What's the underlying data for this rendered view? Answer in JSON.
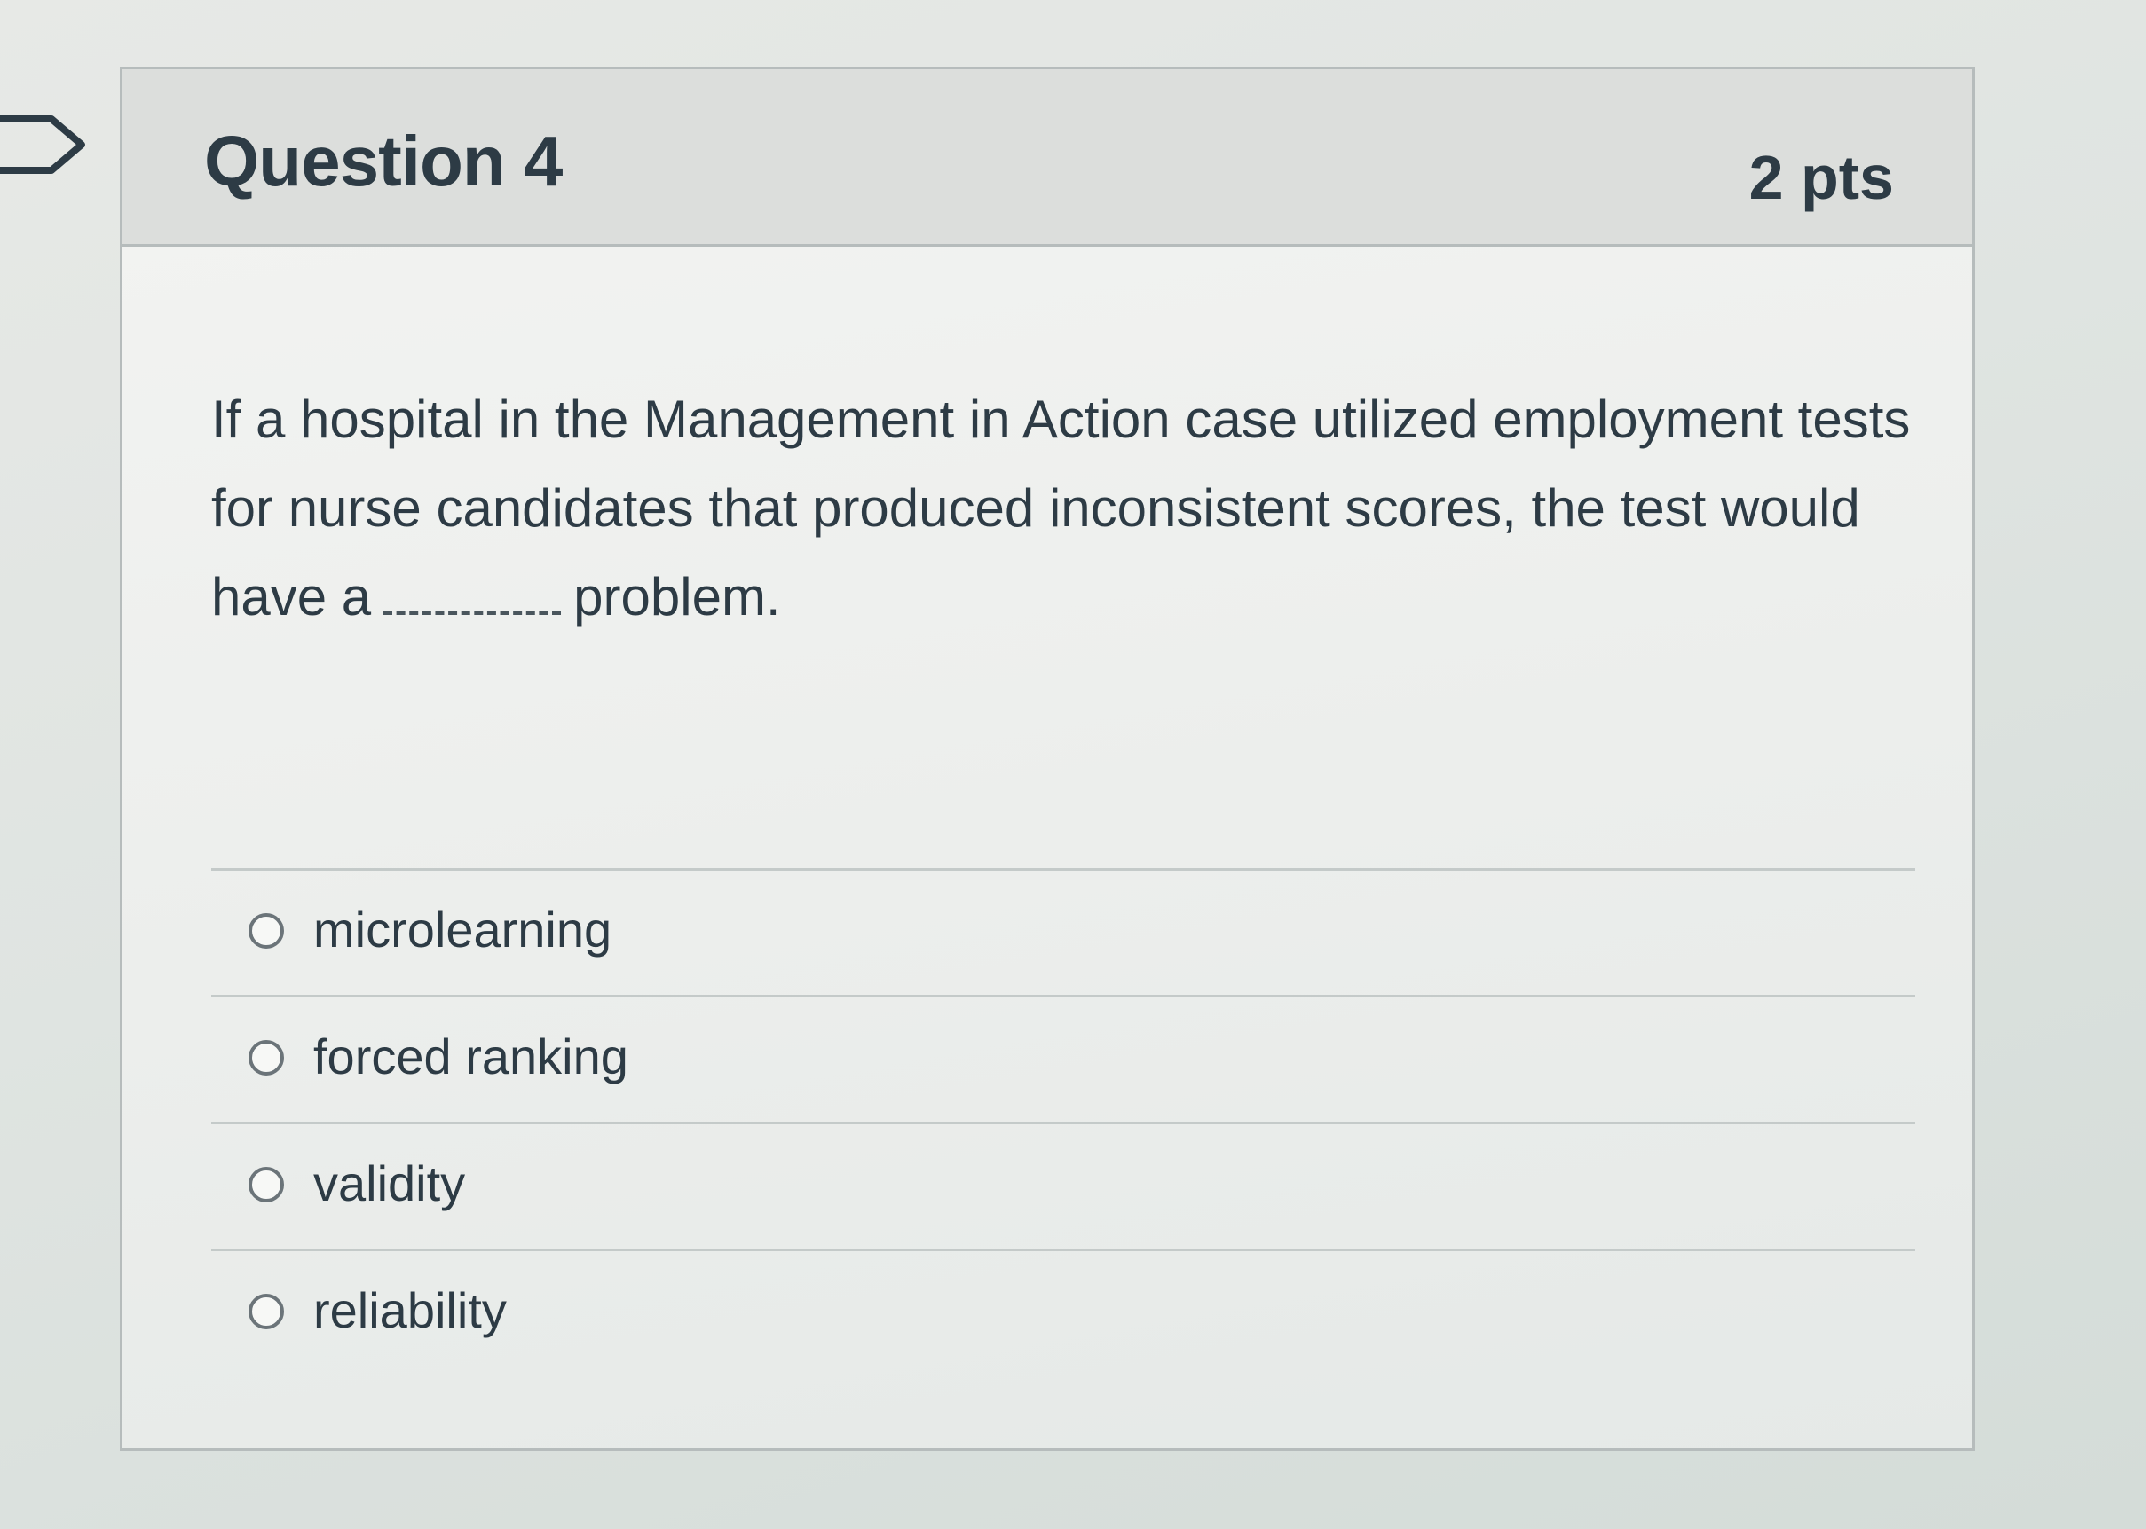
{
  "question": {
    "title": "Question 4",
    "points": "2 pts",
    "text_before_blank": "If a hospital in the Management in Action case utilized employment tests for nurse candidates that produced inconsistent scores, the test would have a",
    "text_after_blank": "problem."
  },
  "answers": [
    {
      "label": "microlearning",
      "selected": false
    },
    {
      "label": "forced ranking",
      "selected": false
    },
    {
      "label": "validity",
      "selected": false
    },
    {
      "label": "reliability",
      "selected": false
    }
  ],
  "colors": {
    "text": "#2d3b45",
    "header_bg": "#dcdedc",
    "border": "#b6bcbc"
  },
  "icons": {
    "flag": "flag-question-icon"
  }
}
